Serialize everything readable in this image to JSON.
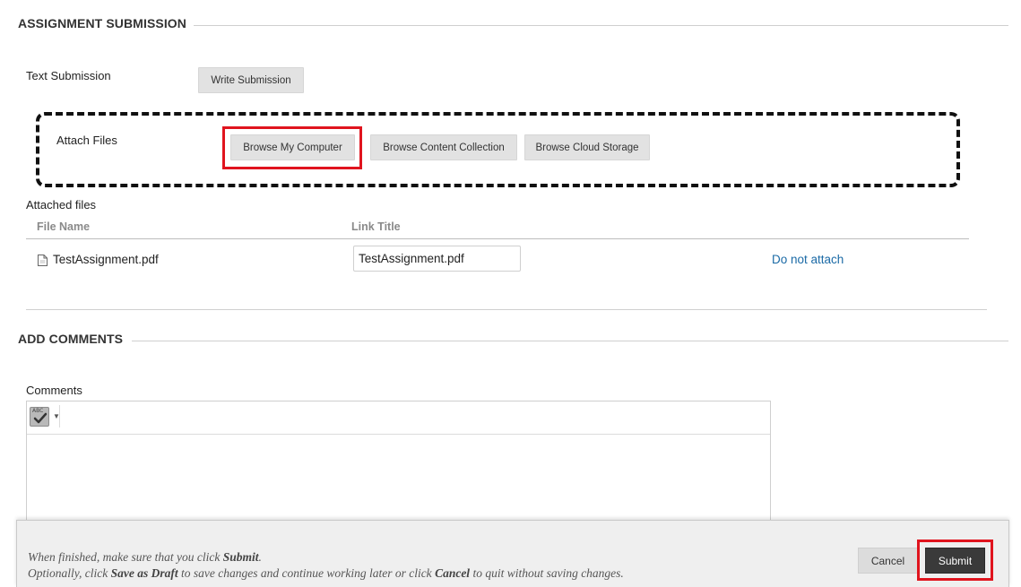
{
  "assignment_submission": {
    "heading": "ASSIGNMENT SUBMISSION",
    "text_submission_label": "Text Submission",
    "write_submission_button": "Write Submission",
    "attach_files_label": "Attach Files",
    "browse_my_computer_button": "Browse My Computer",
    "browse_content_collection_button": "Browse Content Collection",
    "browse_cloud_storage_button": "Browse Cloud Storage"
  },
  "attached_files": {
    "label": "Attached files",
    "columns": [
      "File Name",
      "Link Title"
    ],
    "rows": [
      {
        "file_name": "TestAssignment.pdf",
        "link_title": "TestAssignment.pdf",
        "action": "Do not attach"
      }
    ]
  },
  "add_comments": {
    "heading": "ADD COMMENTS",
    "comments_label": "Comments",
    "spellcheck_icon_text": "ABC"
  },
  "footer": {
    "line1_prefix": "When finished, make sure that you click ",
    "line1_bold": "Submit",
    "line1_suffix": ".",
    "line2_prefix": "Optionally, click ",
    "line2_bold1": "Save as Draft",
    "line2_mid": " to save changes and continue working later or click ",
    "line2_bold2": "Cancel",
    "line2_suffix": " to quit without saving changes.",
    "cancel_button": "Cancel",
    "submit_button": "Submit"
  },
  "colors": {
    "link": "#1b6aa6",
    "highlight_red": "#e0141e",
    "submit_bg": "#3a3a3a"
  }
}
